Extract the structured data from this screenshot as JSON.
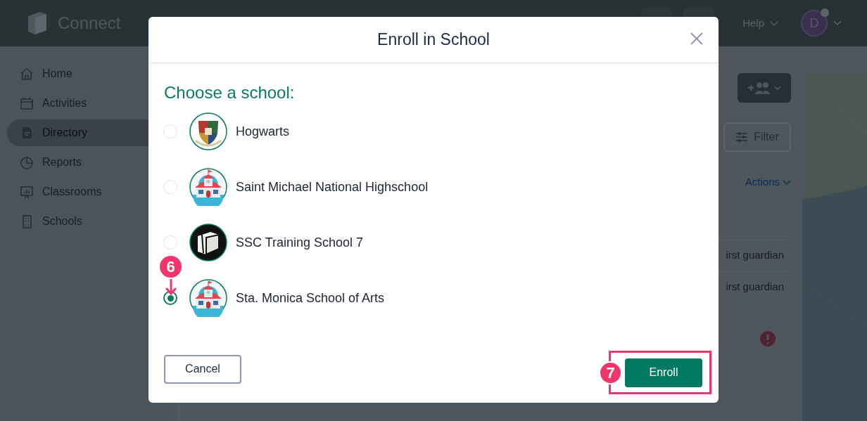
{
  "app": {
    "brand": "Connect",
    "help": "Help",
    "avatar_initial": "D"
  },
  "sidebar": {
    "items": [
      {
        "label": "Home",
        "kind": "home",
        "selected": false
      },
      {
        "label": "Activities",
        "kind": "calendar",
        "selected": false
      },
      {
        "label": "Directory",
        "kind": "document",
        "selected": true
      },
      {
        "label": "Reports",
        "kind": "pie",
        "selected": false
      },
      {
        "label": "Classrooms",
        "kind": "board",
        "selected": false
      },
      {
        "label": "Schools",
        "kind": "building",
        "selected": false
      }
    ]
  },
  "background": {
    "filter": "Filter",
    "actions": "Actions",
    "rows": [
      "irst guardian",
      "irst guardian"
    ]
  },
  "dialog": {
    "title": "Enroll in School",
    "prompt": "Choose a school:",
    "schools": [
      {
        "name": "Hogwarts",
        "kind": "crest",
        "selected": false
      },
      {
        "name": "Saint Michael National Highschool",
        "kind": "schoolhouse",
        "selected": false
      },
      {
        "name": "SSC Training School 7",
        "kind": "book",
        "selected": false
      },
      {
        "name": "Sta. Monica School of Arts",
        "kind": "schoolhouse",
        "selected": true
      }
    ],
    "cancel": "Cancel",
    "confirm": "Enroll"
  },
  "annotations": [
    "6",
    "7"
  ]
}
